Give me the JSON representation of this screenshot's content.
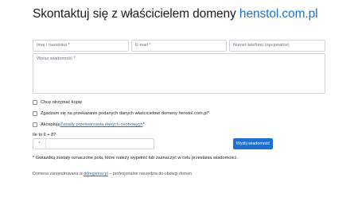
{
  "header": {
    "title_prefix": "Skontaktuj się z właścicielem domeny ",
    "domain": "henstol.com.pl"
  },
  "form": {
    "name_placeholder": "Imię i nazwisko *",
    "email_placeholder": "E-mail *",
    "phone_placeholder": "Numer telefonu (opcjonalne)",
    "message_placeholder": "Wpisz wiadomość *",
    "copy_label": "Chcę otrzymać kopię",
    "consent_label": "Zgadzam się na przekazanie podanych danych właścicielowi domeny henstol.com.pl*",
    "accept_prefix": "Akceptuję ",
    "accept_link": "Zasady przetwarzania danych osobowych",
    "accept_suffix": "*",
    "captcha_question": "Ile to 6 + 8?",
    "captcha_star": "*",
    "submit_label": "Wyślij wiadomość",
    "required_note": "* Gwiazdką zostały oznaczone pola, które należy wypełnić lub zaznaczyć w celu przesłania wiadomości."
  },
  "footer": {
    "prefix": "Domena zarejestrowana w ",
    "link": "ddregistrar.pl",
    "suffix": " – profesjonalne narzędzia do obsługi domen."
  },
  "colors": {
    "accent": "#1a73c8",
    "button": "#1f6fd1"
  }
}
